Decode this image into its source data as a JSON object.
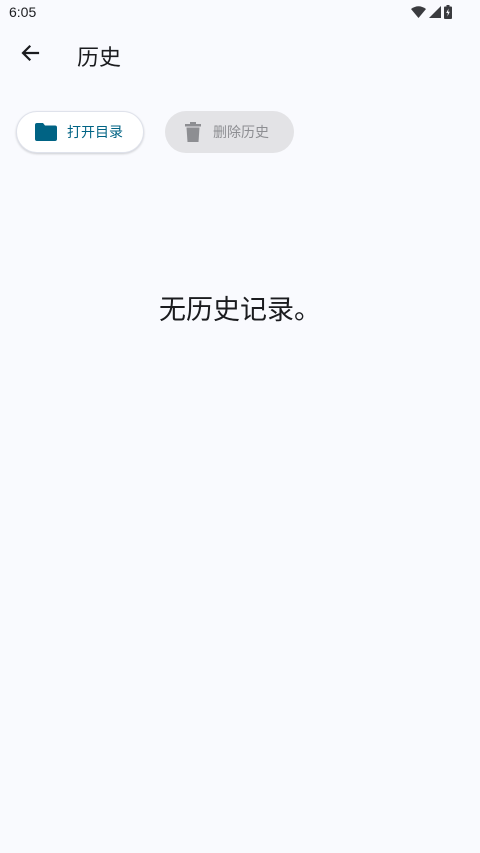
{
  "status_bar": {
    "time": "6:05",
    "icons": [
      "wifi-icon",
      "cell-signal-icon",
      "battery-charging-icon"
    ]
  },
  "app_bar": {
    "back_icon": "arrow-back-icon",
    "title": "历史"
  },
  "actions": {
    "open_directory": {
      "label": "打开目录",
      "icon": "folder-icon",
      "color": "#006384"
    },
    "delete_history": {
      "label": "删除历史",
      "icon": "trash-icon",
      "enabled": false
    }
  },
  "content": {
    "empty_message": "无历史记录。"
  },
  "colors": {
    "background": "#f9fafe",
    "accent": "#006384",
    "disabled_chip": "#e3e3e6"
  }
}
